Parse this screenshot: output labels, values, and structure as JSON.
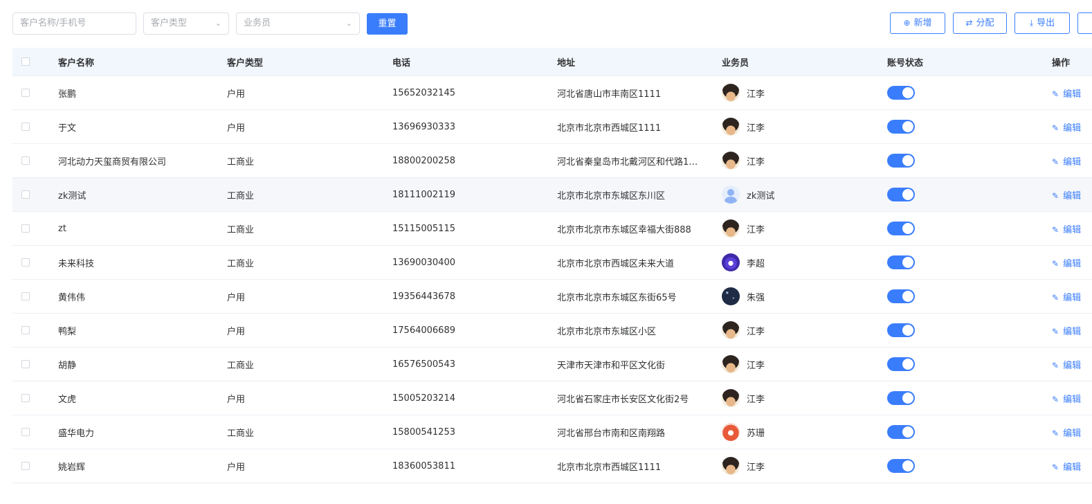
{
  "filters": {
    "name_phone_placeholder": "客户名称/手机号",
    "customer_type_placeholder": "客户类型",
    "salesperson_placeholder": "业务员",
    "reset_label": "重置"
  },
  "actions": {
    "add_label": "新增",
    "assign_label": "分配",
    "export_label": "导出"
  },
  "table": {
    "headers": {
      "name": "客户名称",
      "type": "客户类型",
      "phone": "电话",
      "address": "地址",
      "salesperson": "业务员",
      "status": "账号状态",
      "operation": "操作"
    },
    "edit_label": "编辑",
    "rows": [
      {
        "name": "张鹏",
        "type": "户用",
        "phone": "15652032145",
        "address": "河北省唐山市丰南区1111",
        "salesperson": "江李",
        "avatar": "anime",
        "enabled": true
      },
      {
        "name": "于文",
        "type": "户用",
        "phone": "13696930333",
        "address": "北京市北京市西城区1111",
        "salesperson": "江李",
        "avatar": "anime",
        "enabled": true
      },
      {
        "name": "河北动力天玺商贸有限公司",
        "type": "工商业",
        "phone": "18800200258",
        "address": "河北省秦皇岛市北戴河区和代路11...",
        "salesperson": "江李",
        "avatar": "anime",
        "enabled": true
      },
      {
        "name": "zk测试",
        "type": "工商业",
        "phone": "18111002119",
        "address": "北京市北京市东城区东川区",
        "salesperson": "zk测试",
        "avatar": "default",
        "enabled": true
      },
      {
        "name": "zt",
        "type": "工商业",
        "phone": "15115005115",
        "address": "北京市北京市东城区幸福大街888",
        "salesperson": "江李",
        "avatar": "anime",
        "enabled": true
      },
      {
        "name": "未来科技",
        "type": "工商业",
        "phone": "13690030400",
        "address": "北京市北京市西城区未来大道",
        "salesperson": "李超",
        "avatar": "flame",
        "enabled": true
      },
      {
        "name": "黄伟伟",
        "type": "户用",
        "phone": "19356443678",
        "address": "北京市北京市东城区东街65号",
        "salesperson": "朱强",
        "avatar": "stars",
        "enabled": true
      },
      {
        "name": "鸭梨",
        "type": "户用",
        "phone": "17564006689",
        "address": "北京市北京市东城区小区",
        "salesperson": "江李",
        "avatar": "anime",
        "enabled": true
      },
      {
        "name": "胡静",
        "type": "工商业",
        "phone": "16576500543",
        "address": "天津市天津市和平区文化街",
        "salesperson": "江李",
        "avatar": "anime",
        "enabled": true
      },
      {
        "name": "文虎",
        "type": "户用",
        "phone": "15005203214",
        "address": "河北省石家庄市长安区文化街2号",
        "salesperson": "江李",
        "avatar": "anime",
        "enabled": true
      },
      {
        "name": "盛华电力",
        "type": "工商业",
        "phone": "15800541253",
        "address": "河北省邢台市南和区南翔路",
        "salesperson": "苏珊",
        "avatar": "fox",
        "enabled": true
      },
      {
        "name": "姚岩辉",
        "type": "户用",
        "phone": "18360053811",
        "address": "北京市北京市西城区1111",
        "salesperson": "江李",
        "avatar": "anime",
        "enabled": true
      }
    ]
  },
  "colors": {
    "primary": "#3a7dfc",
    "header_bg": "#f2f7fd",
    "border": "#ebeef5"
  }
}
